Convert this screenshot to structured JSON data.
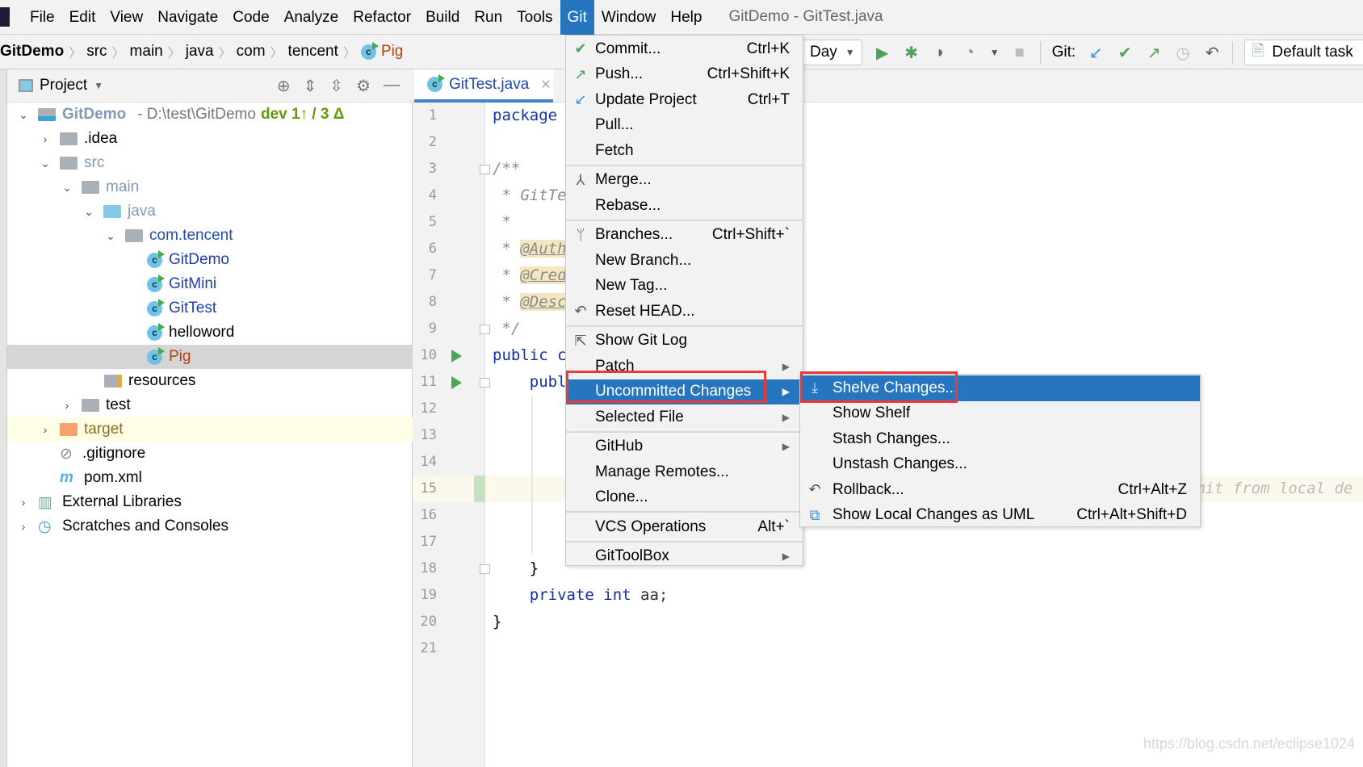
{
  "menubar": {
    "items": [
      "File",
      "Edit",
      "View",
      "Navigate",
      "Code",
      "Analyze",
      "Refactor",
      "Build",
      "Run",
      "Tools",
      "Git",
      "Window",
      "Help"
    ],
    "active": "Git",
    "window_title": "GitDemo - GitTest.java"
  },
  "breadcrumb": [
    "GitDemo",
    "src",
    "main",
    "java",
    "com",
    "tencent",
    "Pig"
  ],
  "toolbar": {
    "run_config": "Day",
    "git_label": "Git:",
    "task": "Default task"
  },
  "project": {
    "header": "Project",
    "root": {
      "name": "GitDemo",
      "path": "- D:\\test\\GitDemo",
      "branch": "dev 1↑ / 3 Δ"
    },
    "tree": [
      ".idea",
      "src",
      "main",
      "java",
      "com.tencent",
      "GitDemo",
      "GitMini",
      "GitTest",
      "helloword",
      "Pig",
      "resources",
      "test",
      "target",
      ".gitignore",
      "pom.xml",
      "External Libraries",
      "Scratches and Consoles"
    ],
    "selected": "Pig"
  },
  "editor": {
    "tab": "GitTest.java",
    "lines": {
      "1": "package",
      "3": "/**",
      "4": " * GitTe",
      "5": " *",
      "6a": " * ",
      "6b": "@Auth",
      "7a": " * ",
      "7b": "@Cred",
      "8a": " * ",
      "8b": "@Desc",
      "9": " */",
      "10": "public c",
      "11": "    publ",
      "15": "mit from local de",
      "18": "    }",
      "19a": "    private int",
      "19b": " aa;",
      "20": "}"
    },
    "line_count": 21
  },
  "git_menu": [
    {
      "label": "Commit...",
      "shortcut": "Ctrl+K",
      "icon": "check-icon"
    },
    {
      "label": "Push...",
      "shortcut": "Ctrl+Shift+K",
      "icon": "push-arrow-icon"
    },
    {
      "label": "Update Project",
      "shortcut": "Ctrl+T",
      "icon": "update-arrow-icon"
    },
    {
      "label": "Pull..."
    },
    {
      "label": "Fetch"
    },
    {
      "label": "Merge...",
      "icon": "merge-icon"
    },
    {
      "label": "Rebase..."
    },
    {
      "label": "Branches...",
      "shortcut": "Ctrl+Shift+`",
      "icon": "branch-icon"
    },
    {
      "label": "New Branch..."
    },
    {
      "label": "New Tag..."
    },
    {
      "label": "Reset HEAD...",
      "icon": "undo-icon"
    },
    {
      "label": "Show Git Log",
      "icon": "git-log-icon"
    },
    {
      "label": "Patch"
    },
    {
      "label": "Uncommitted Changes"
    },
    {
      "label": "Selected File"
    },
    {
      "label": "GitHub"
    },
    {
      "label": "Manage Remotes..."
    },
    {
      "label": "Clone..."
    },
    {
      "label": "VCS Operations",
      "shortcut": "Alt+`"
    },
    {
      "label": "GitToolBox"
    }
  ],
  "submenu": [
    {
      "label": "Shelve Changes...",
      "icon": "shelve-icon"
    },
    {
      "label": "Show Shelf"
    },
    {
      "label": "Stash Changes..."
    },
    {
      "label": "Unstash Changes..."
    },
    {
      "label": "Rollback...",
      "shortcut": "Ctrl+Alt+Z",
      "icon": "undo-icon"
    },
    {
      "label": "Show Local Changes as UML",
      "shortcut": "Ctrl+Alt+Shift+D",
      "icon": "uml-icon"
    }
  ],
  "watermark": "https://blog.csdn.net/eclipse1024",
  "colors": {
    "accent": "#2675bf",
    "highlight_box": "#ee3838",
    "keyword": "#1232a8"
  }
}
